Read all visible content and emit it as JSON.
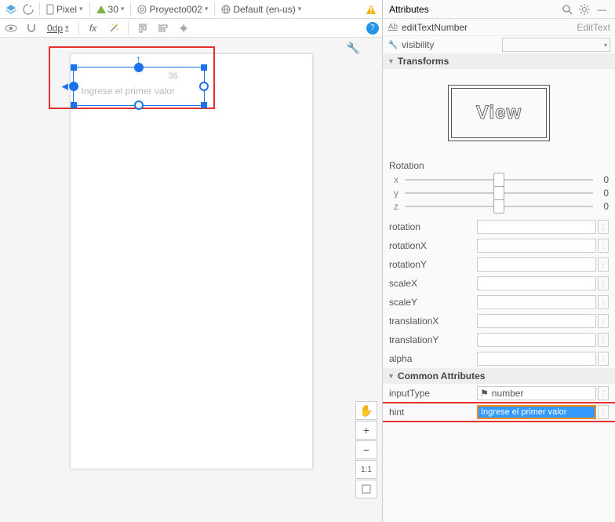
{
  "toolbar": {
    "device": "Pixel",
    "api": "30",
    "project": "Proyecto002",
    "locale": "Default (en-us)"
  },
  "secondToolbar": {
    "dp": "0dp"
  },
  "designPreview": {
    "hintText": "Ingrese el primer valor",
    "dimensionLabel": "36"
  },
  "attributes": {
    "title": "Attributes",
    "selectedId": "editTextNumber",
    "selectedType": "EditText",
    "visibilityLabel": "visibility",
    "transforms": {
      "header": "Transforms",
      "viewLabel": "View",
      "rotationLabel": "Rotation",
      "axes": {
        "x": "x",
        "y": "y",
        "z": "z"
      },
      "axisValues": {
        "x": "0",
        "y": "0",
        "z": "0"
      },
      "rows": [
        {
          "name": "rotation",
          "value": ""
        },
        {
          "name": "rotationX",
          "value": ""
        },
        {
          "name": "rotationY",
          "value": ""
        },
        {
          "name": "scaleX",
          "value": ""
        },
        {
          "name": "scaleY",
          "value": ""
        },
        {
          "name": "translationX",
          "value": ""
        },
        {
          "name": "translationY",
          "value": ""
        },
        {
          "name": "alpha",
          "value": ""
        }
      ]
    },
    "common": {
      "header": "Common Attributes",
      "inputTypeLabel": "inputType",
      "inputTypeValue": "number",
      "hintLabel": "hint",
      "hintValue": "Ingrese el primer valor"
    }
  }
}
